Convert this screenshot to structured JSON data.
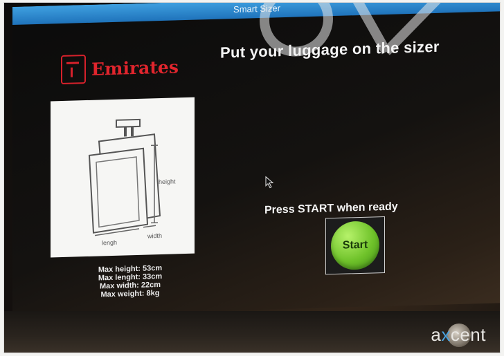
{
  "window": {
    "title": "Smart Sizer"
  },
  "logo": {
    "text": "Emirates"
  },
  "headline": "Put your luggage on the sizer",
  "diagram": {
    "labels": {
      "height": "height",
      "length": "lengh",
      "width": "width"
    }
  },
  "specs": [
    "Max height: 53cm",
    "Max lenght: 33cm",
    "Max width: 22cm",
    "Max weight: 8kg"
  ],
  "prompt": "Press START when ready",
  "start_button": {
    "label": "Start",
    "color": "#6fc22a"
  },
  "brand": {
    "prefix": "a",
    "x": "x",
    "suffix": "cent"
  },
  "colors": {
    "titlebar": "#1f73bb",
    "logo_red": "#e0252d"
  }
}
